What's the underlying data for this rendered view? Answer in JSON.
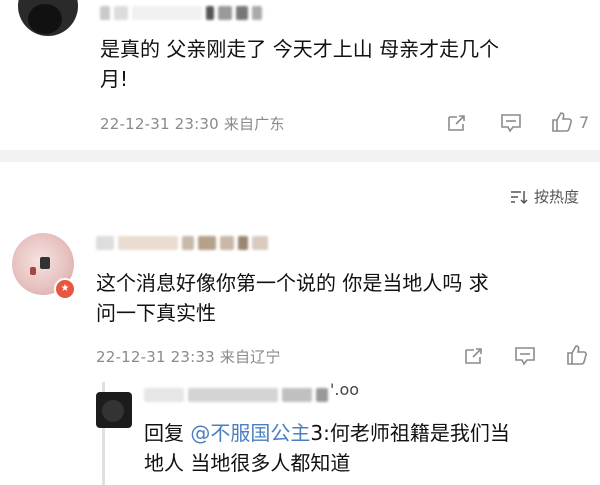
{
  "comment1": {
    "text_line1": "是真的 父亲刚走了 今天才上山 母亲才走几个",
    "text_line2": "月!",
    "timestamp": "22-12-31 23:30",
    "location": "来自广东",
    "like_count": "7"
  },
  "sort": {
    "label": "按热度"
  },
  "comment2": {
    "text_line1": "这个消息好像你第一个说的 你是当地人吗 求",
    "text_line2": "问一下真实性",
    "timestamp": "22-12-31 23:33",
    "location": "来自辽宁"
  },
  "reply": {
    "prefix": "回复",
    "mention": "@不服国公主",
    "rest_line1": "3:何老师祖籍是我们当",
    "text_line2": "地人 当地很多人都知道",
    "name_suffix": "'.oo"
  },
  "colors": {
    "accent_link": "#4a7fc1",
    "meta_gray": "#8a8a8a",
    "divider": "#f2f2f2"
  },
  "icons": [
    "share-icon",
    "comment-icon",
    "like-icon",
    "sort-icon"
  ]
}
